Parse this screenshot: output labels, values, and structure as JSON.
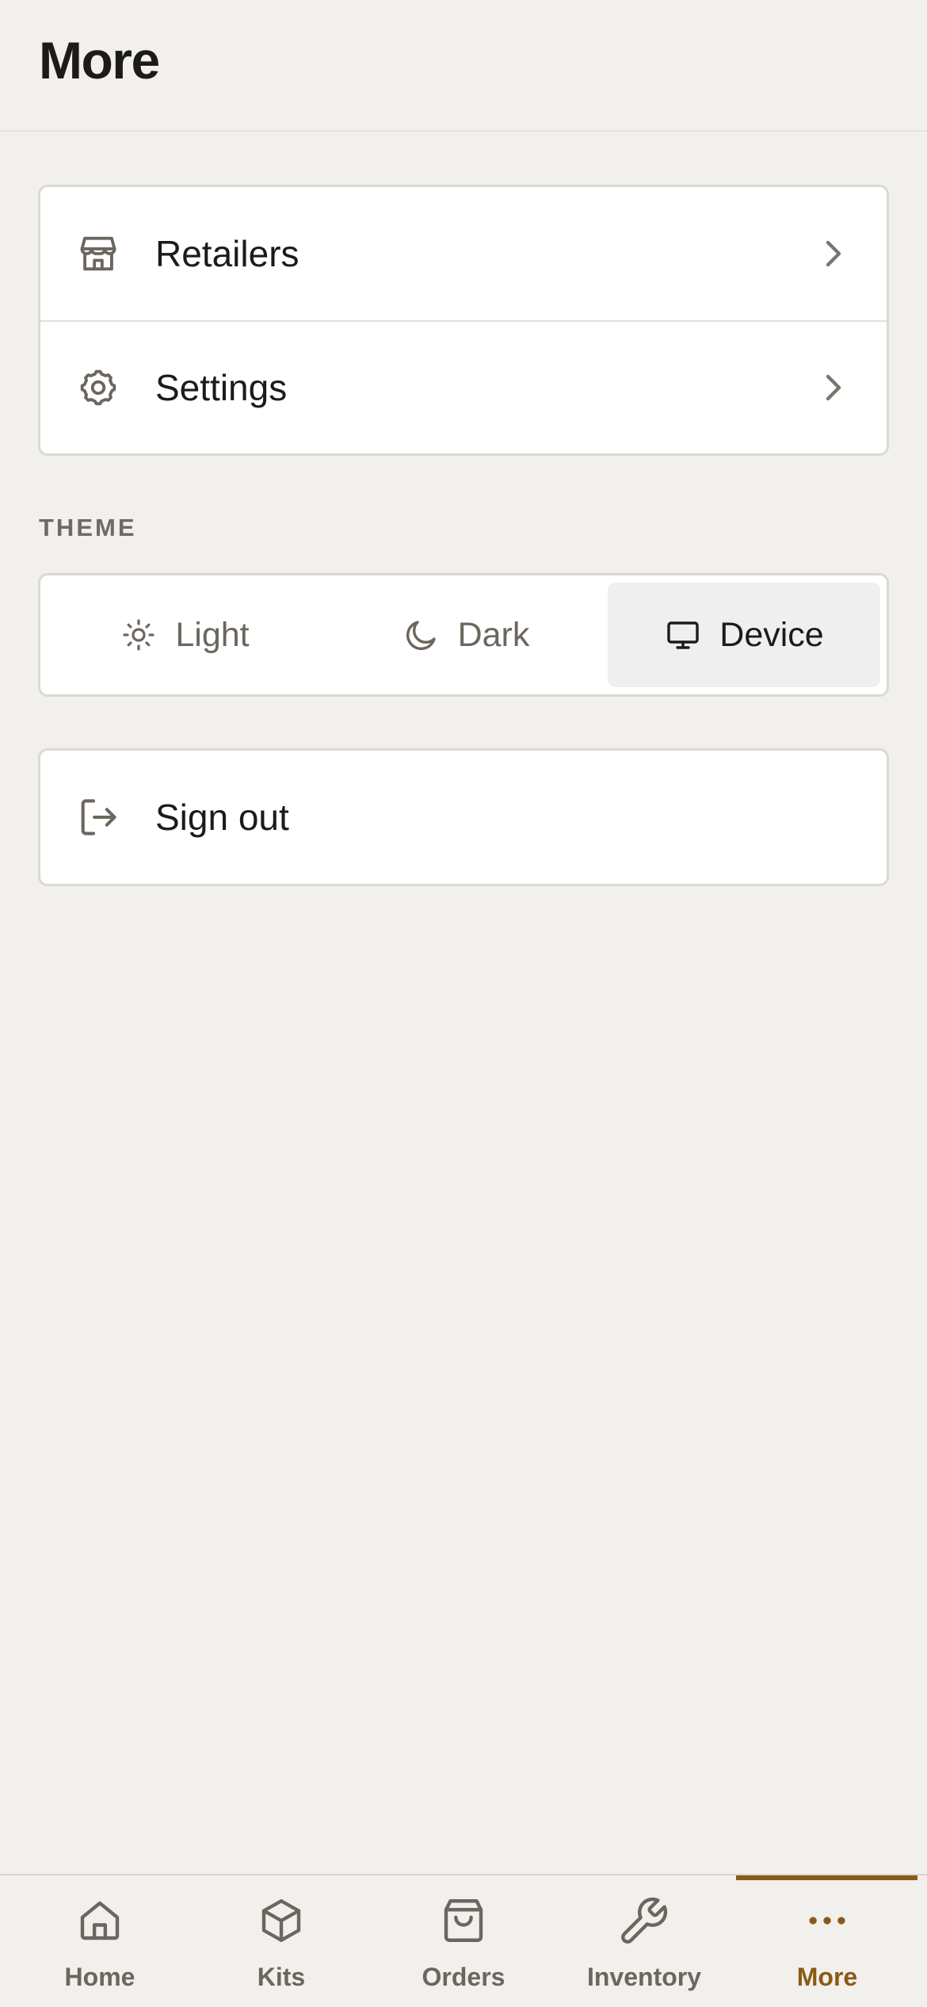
{
  "header": {
    "title": "More"
  },
  "menu": {
    "items": [
      {
        "label": "Retailers",
        "icon": "store-icon"
      },
      {
        "label": "Settings",
        "icon": "gear-icon"
      }
    ]
  },
  "theme": {
    "section_label": "THEME",
    "options": [
      {
        "label": "Light",
        "icon": "sun-icon"
      },
      {
        "label": "Dark",
        "icon": "moon-icon"
      },
      {
        "label": "Device",
        "icon": "monitor-icon"
      }
    ],
    "selected": "Device"
  },
  "sign_out": {
    "label": "Sign out",
    "icon": "logout-icon"
  },
  "tabbar": {
    "tabs": [
      {
        "label": "Home",
        "icon": "home-icon"
      },
      {
        "label": "Kits",
        "icon": "box-icon"
      },
      {
        "label": "Orders",
        "icon": "shopping-bag-icon"
      },
      {
        "label": "Inventory",
        "icon": "wrench-icon"
      },
      {
        "label": "More",
        "icon": "more-dots-icon"
      }
    ],
    "active": "More"
  },
  "colors": {
    "background": "#f1f0ec",
    "card": "#ffffff",
    "accent": "#8a5a16",
    "text_primary": "#1d1b18",
    "text_muted": "#6b665e"
  }
}
